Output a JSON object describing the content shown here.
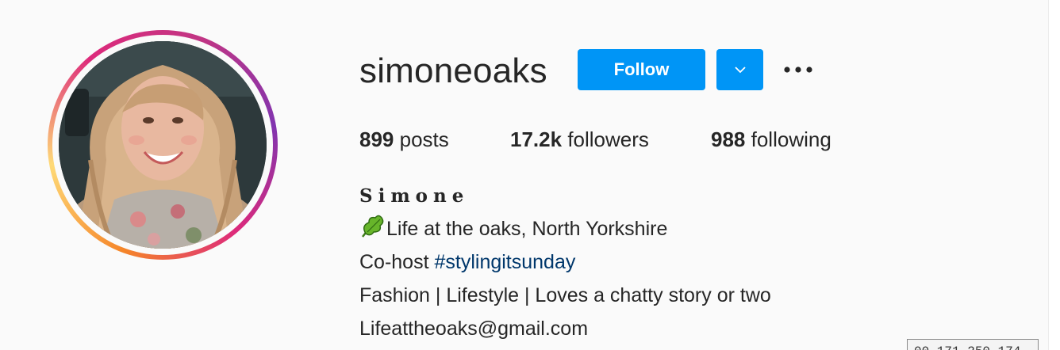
{
  "profile": {
    "username": "simoneoaks",
    "follow_label": "Follow",
    "dropdown_icon": "chevron-down-icon",
    "more_icon": "more-options-icon"
  },
  "stats": {
    "posts_count": "899",
    "posts_label": "posts",
    "followers_count": "17.2k",
    "followers_label": "followers",
    "following_count": "988",
    "following_label": "following"
  },
  "bio": {
    "full_name": "Simone",
    "location_line": "Life at the oaks, North Yorkshire",
    "cohost_prefix": "Co-host ",
    "hashtag": "#stylingitsunday",
    "tagline": "Fashion | Lifestyle | Loves a chatty story or two",
    "email": "Lifeattheoaks@gmail.com"
  },
  "tooltip": {
    "text": "00.171.250.174"
  },
  "colors": {
    "accent": "#0095f6",
    "hashtag": "#00376b",
    "text": "#262626",
    "background": "#fafafa"
  }
}
